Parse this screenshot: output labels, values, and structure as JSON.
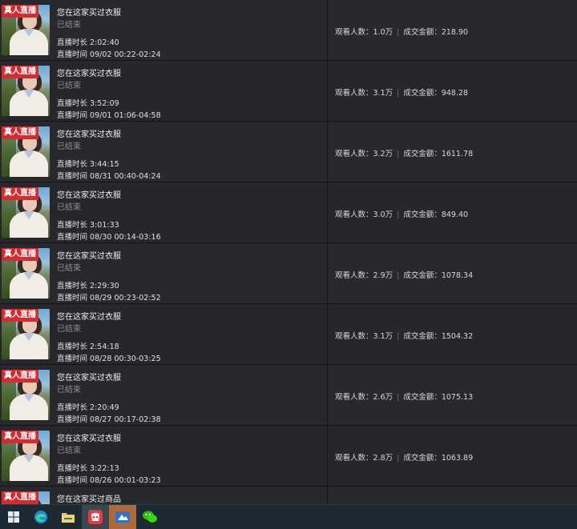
{
  "labels": {
    "badge": "真人直播",
    "status": "已结束",
    "duration_prefix": "直播时长",
    "timerange_prefix": "直播时间",
    "viewers_prefix": "观看人数：",
    "amount_prefix": "成交金额：",
    "separator": "|"
  },
  "rows": [
    {
      "title": "您在这家买过衣服",
      "duration": "2:02:40",
      "timerange": "09/02 00:22-02:24",
      "viewers": "1.0万",
      "amount": "218.90"
    },
    {
      "title": "您在这家买过衣服",
      "duration": "3:52:09",
      "timerange": "09/01 01:06-04:58",
      "viewers": "3.1万",
      "amount": "948.28"
    },
    {
      "title": "您在这家买过衣服",
      "duration": "3:44:15",
      "timerange": "08/31 00:40-04:24",
      "viewers": "3.2万",
      "amount": "1611.78"
    },
    {
      "title": "您在这家买过衣服",
      "duration": "3:01:33",
      "timerange": "08/30 00:14-03:16",
      "viewers": "3.0万",
      "amount": "849.40"
    },
    {
      "title": "您在这家买过衣服",
      "duration": "2:29:30",
      "timerange": "08/29 00:23-02:52",
      "viewers": "2.9万",
      "amount": "1078.34"
    },
    {
      "title": "您在这家买过衣服",
      "duration": "2:54:18",
      "timerange": "08/28 00:30-03:25",
      "viewers": "3.1万",
      "amount": "1504.32"
    },
    {
      "title": "您在这家买过衣服",
      "duration": "2:20:49",
      "timerange": "08/27 00:17-02:38",
      "viewers": "2.6万",
      "amount": "1075.13"
    },
    {
      "title": "您在这家买过衣服",
      "duration": "3:22:13",
      "timerange": "08/26 00:01-03:23",
      "viewers": "2.8万",
      "amount": "1063.89"
    },
    {
      "title": "您在这家买过商品",
      "duration": "",
      "timerange": "",
      "viewers": "",
      "amount": ""
    }
  ],
  "taskbar": {
    "items": [
      {
        "icon": "windows-start-icon"
      },
      {
        "icon": "edge-browser-icon"
      },
      {
        "icon": "file-explorer-icon"
      },
      {
        "icon": "shopping-app-icon"
      },
      {
        "icon": "media-app-icon"
      },
      {
        "icon": "wechat-icon"
      }
    ]
  },
  "colors": {
    "badge": "#d8292e",
    "row_bg": "#28292c",
    "taskbar_bg": "#1e2a33"
  }
}
